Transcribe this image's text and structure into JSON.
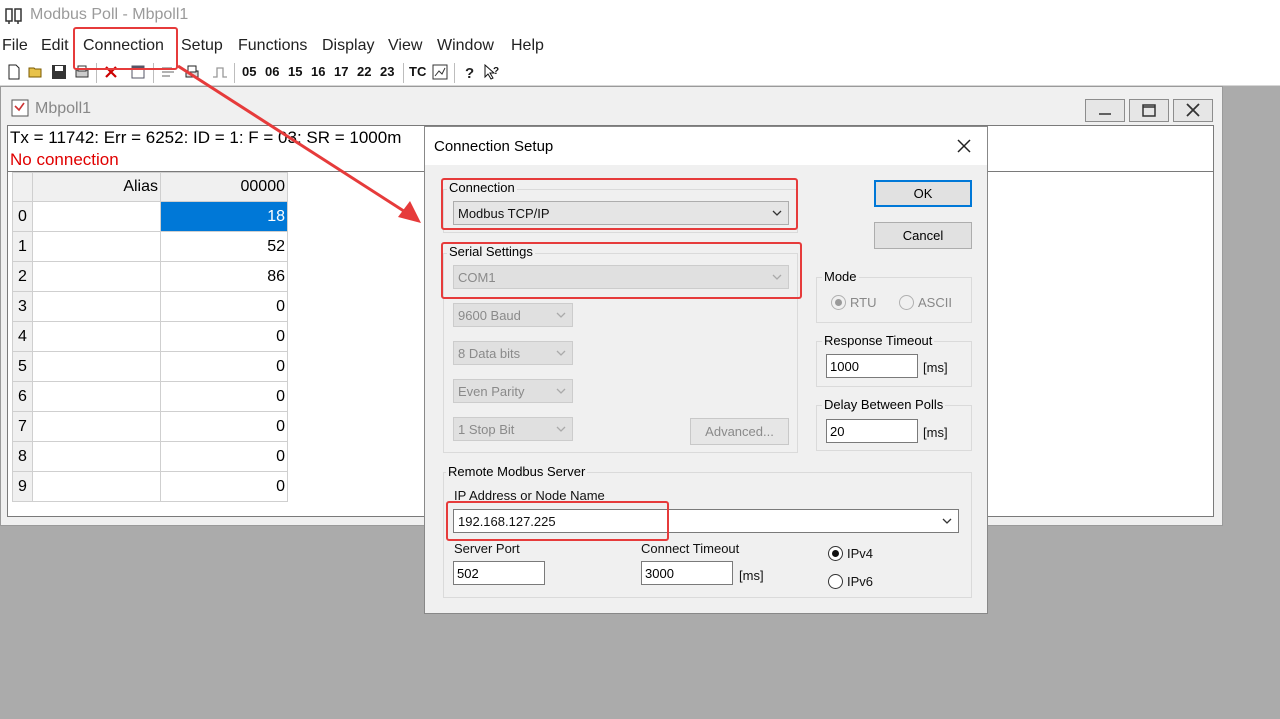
{
  "app": {
    "title": "Modbus Poll - Mbpoll1"
  },
  "menu": [
    "File",
    "Edit",
    "Connection",
    "Setup",
    "Functions",
    "Display",
    "View",
    "Window",
    "Help"
  ],
  "toolbar": {
    "function_codes": [
      "05",
      "06",
      "15",
      "16",
      "17",
      "22",
      "23"
    ],
    "tc_label": "TC",
    "icons": [
      "new-icon",
      "open-icon",
      "save-icon",
      "print-icon",
      "delete-icon",
      "window-icon",
      "read-write-icon",
      "print-small-icon",
      "pulse-icon",
      "communication-icon",
      "help-icon",
      "context-help-icon"
    ]
  },
  "window": {
    "title": "Mbpoll1",
    "status_line": "Tx = 11742: Err = 6252: ID = 1: F = 03: SR = 1000m",
    "connection_status": "No connection",
    "table": {
      "headers": [
        "Alias",
        "00000"
      ],
      "rows": [
        {
          "index": "0",
          "alias": "",
          "value": "18"
        },
        {
          "index": "1",
          "alias": "",
          "value": "52"
        },
        {
          "index": "2",
          "alias": "",
          "value": "86"
        },
        {
          "index": "3",
          "alias": "",
          "value": "0"
        },
        {
          "index": "4",
          "alias": "",
          "value": "0"
        },
        {
          "index": "5",
          "alias": "",
          "value": "0"
        },
        {
          "index": "6",
          "alias": "",
          "value": "0"
        },
        {
          "index": "7",
          "alias": "",
          "value": "0"
        },
        {
          "index": "8",
          "alias": "",
          "value": "0"
        },
        {
          "index": "9",
          "alias": "",
          "value": "0"
        }
      ]
    }
  },
  "dialog": {
    "title": "Connection Setup",
    "connection": {
      "label": "Connection",
      "value": "Modbus TCP/IP"
    },
    "serial": {
      "label": "Serial Settings",
      "port": "COM1",
      "baud": "9600 Baud",
      "data_bits": "8 Data bits",
      "parity": "Even Parity",
      "stop_bits": "1 Stop Bit",
      "advanced": "Advanced..."
    },
    "ok": "OK",
    "cancel": "Cancel",
    "mode": {
      "label": "Mode",
      "rtu": "RTU",
      "ascii": "ASCII",
      "selected": "RTU"
    },
    "response_timeout": {
      "label": "Response Timeout",
      "value": "1000",
      "unit": "[ms]"
    },
    "delay_between_polls": {
      "label": "Delay Between Polls",
      "value": "20",
      "unit": "[ms]"
    },
    "remote": {
      "label": "Remote Modbus Server",
      "ip_label": "IP Address or Node Name",
      "ip_value": "192.168.127.225",
      "port_label": "Server Port",
      "port_value": "502",
      "timeout_label": "Connect Timeout",
      "timeout_value": "3000",
      "timeout_unit": "[ms]",
      "ipv4": "IPv4",
      "ipv6": "IPv6",
      "selected": "IPv4"
    }
  },
  "colors": {
    "annotation": "#e63b3b",
    "selection": "#0078d7",
    "error_text": "#e00000"
  }
}
